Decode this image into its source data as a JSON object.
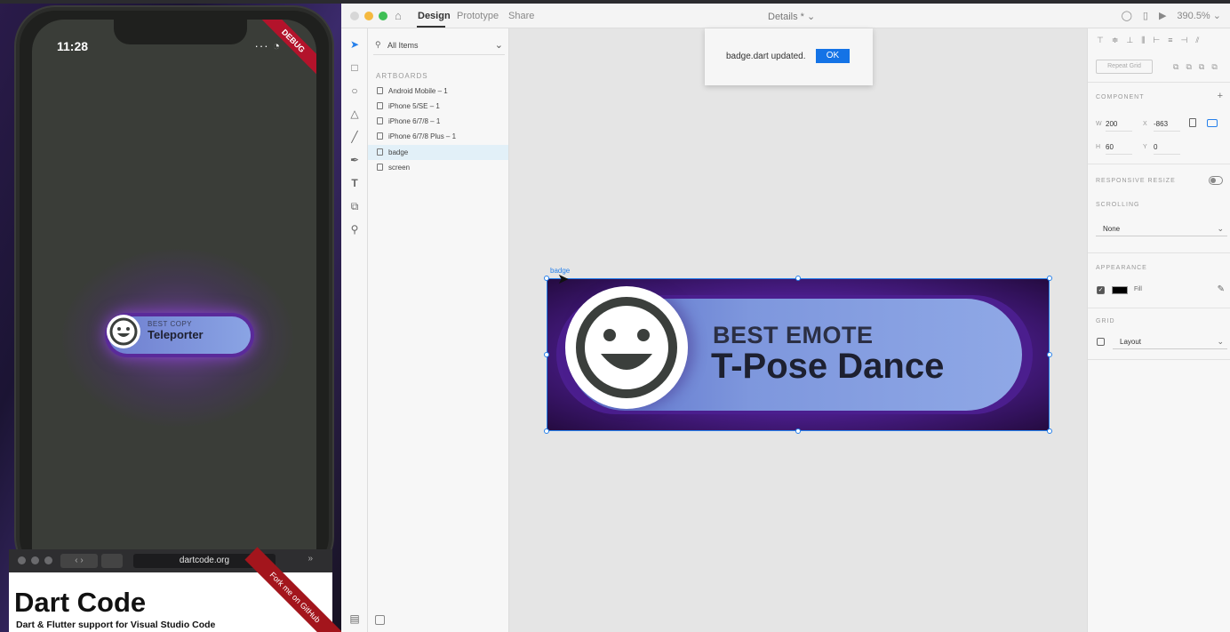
{
  "colors": {
    "accent": "#2680eb",
    "ok_button": "#1473e6",
    "badge_purple": "#4b1e8e",
    "badge_blue": "#8fa8e6"
  },
  "phone": {
    "time": "11:28",
    "status": "···",
    "debug_ribbon": "DEBUG",
    "mini_badge": {
      "sup": "BEST COPY",
      "title": "Teleporter"
    }
  },
  "browser": {
    "url": "dartcode.org",
    "site_title": "Dart Code",
    "site_subtitle": "Dart & Flutter support for Visual Studio Code",
    "fork_ribbon": "Fork me on GitHub"
  },
  "xd": {
    "tabs": [
      "Design",
      "Prototype",
      "Share"
    ],
    "doc_title": "Details * ⌄",
    "zoom": "390.5% ⌄",
    "layers": {
      "search_label": "All Items",
      "section": "ARTBOARDS",
      "items": [
        {
          "label": "Android Mobile – 1",
          "selected": false
        },
        {
          "label": "iPhone 5/SE – 1",
          "selected": false
        },
        {
          "label": "iPhone 6/7/8 – 1",
          "selected": false
        },
        {
          "label": "iPhone 6/7/8 Plus – 1",
          "selected": false
        },
        {
          "label": "badge",
          "selected": true
        },
        {
          "label": "screen",
          "selected": false
        }
      ]
    },
    "toast": {
      "message": "badge.dart updated.",
      "ok": "OK"
    },
    "artboard_label": "badge",
    "badge": {
      "sup": "BEST EMOTE",
      "title": "T-Pose Dance"
    },
    "props": {
      "repeat_grid": "Repeat Grid",
      "component": "COMPONENT",
      "w_label": "W",
      "w_value": "200",
      "x_label": "X",
      "x_value": "-863",
      "h_label": "H",
      "h_value": "60",
      "y_label": "Y",
      "y_value": "0",
      "responsive_resize": "RESPONSIVE RESIZE",
      "scrolling": "SCROLLING",
      "scrolling_value": "None",
      "appearance": "APPEARANCE",
      "fill_label": "Fill",
      "grid": "GRID",
      "grid_value": "Layout"
    }
  }
}
